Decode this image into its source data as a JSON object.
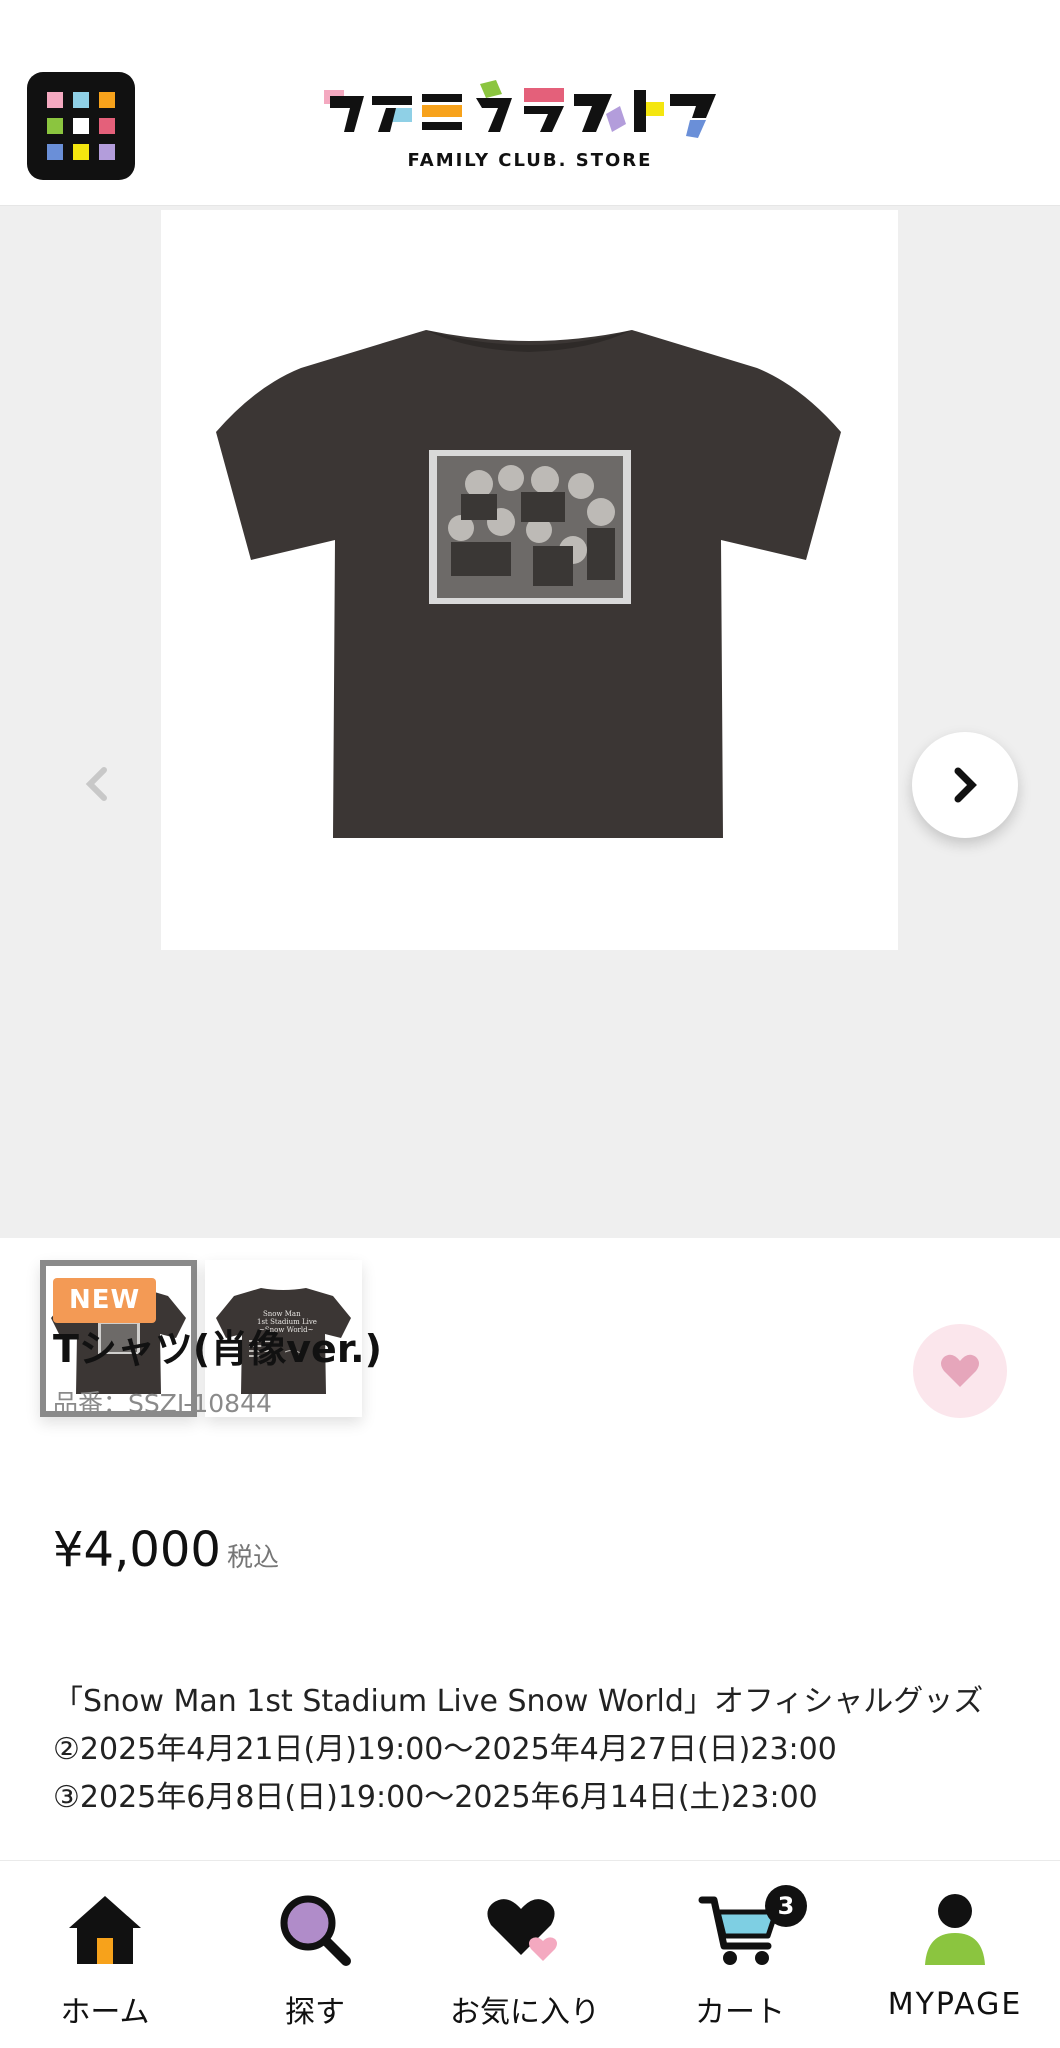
{
  "header": {
    "logo_text": "ファミクラストア",
    "logo_sub": "FAMILY CLUB. STORE",
    "menu_colors": [
      "#f4a9c0",
      "#8fd0e6",
      "#f7a21b",
      "#8bc53f",
      "#ffffff",
      "#e4607a",
      "#6a8fd8",
      "#f4e60f",
      "#b39ddb"
    ]
  },
  "product": {
    "badge": "NEW",
    "title": "Tシャツ(肖像ver.)",
    "code": "品番：SSZJ-10844",
    "price": "¥4,000",
    "tax_label": "税込",
    "description": [
      "「Snow Man 1st Stadium Live Snow World」オフィシャルグッズ",
      "②2025年4月21日(月)19:00～2025年4月27日(日)23:00",
      "③2025年6月8日(日)19:00～2025年6月14日(土)23:00"
    ],
    "back_print_lines": [
      "Snow Man",
      "1st Stadium Live",
      "~Snow World~"
    ]
  },
  "nav": {
    "home": "ホーム",
    "search": "探す",
    "favorites": "お気に入り",
    "cart": "カート",
    "cart_count": "3",
    "mypage": "MYPAGE"
  },
  "colors": {
    "badge": "#f39a55",
    "fav_bg": "#fbe6ec",
    "fav_heart": "#e6a6bb",
    "shirt": "#3b3634",
    "search_lens": "#b08cc9",
    "cart_fill": "#7ecfe3",
    "mypage_body": "#8bc53f",
    "home_door": "#f7a21b"
  }
}
